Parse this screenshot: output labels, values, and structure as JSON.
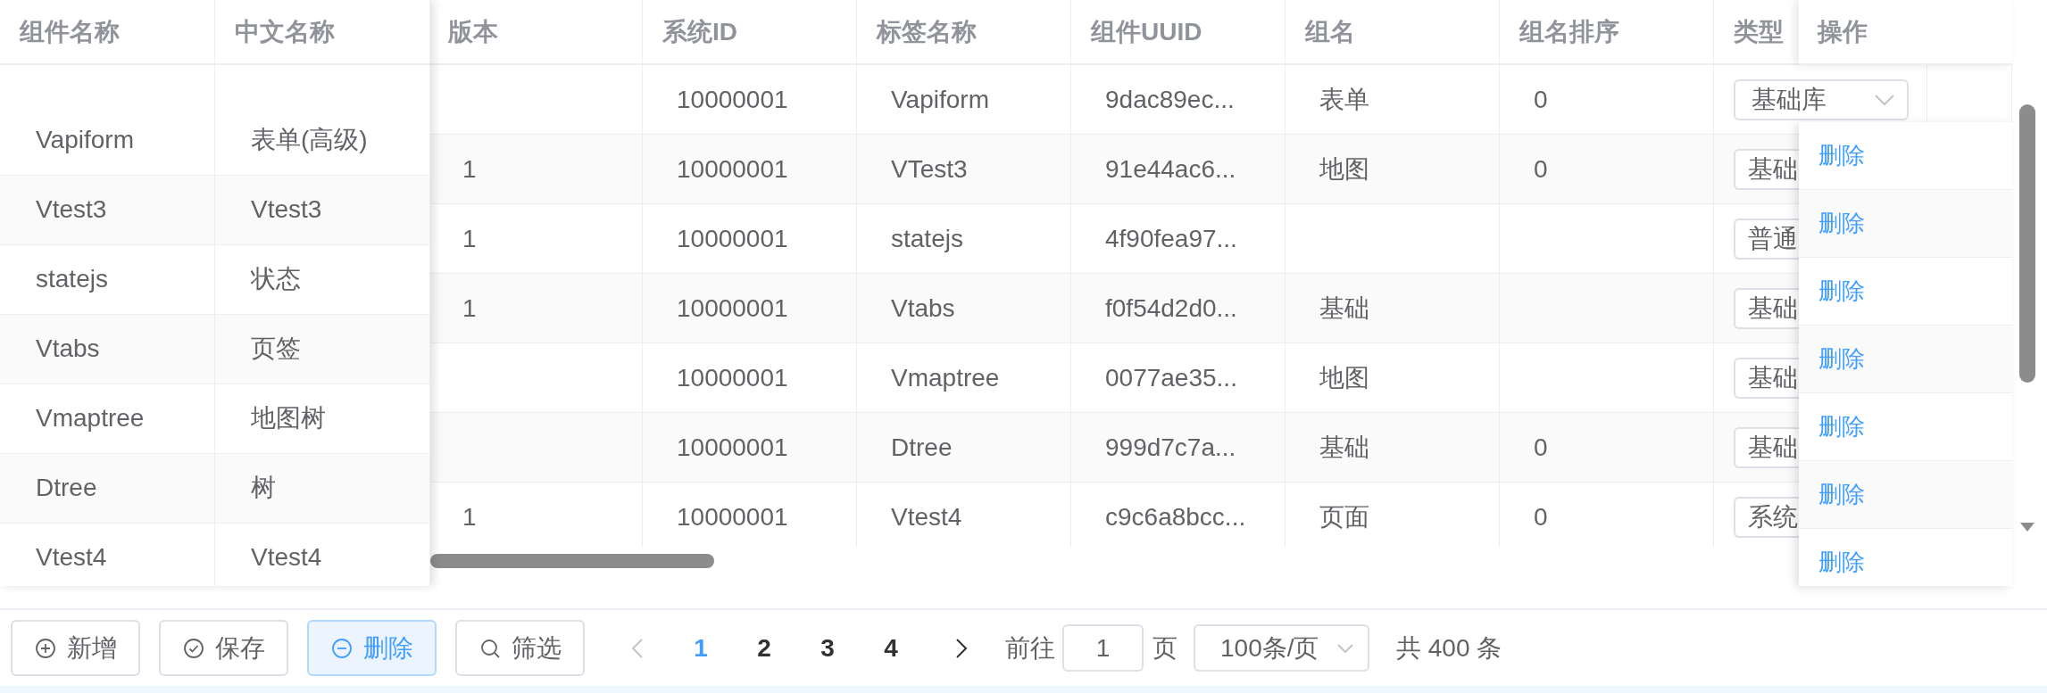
{
  "table": {
    "columns": [
      "组件名称",
      "中文名称",
      "版本",
      "系统ID",
      "标签名称",
      "组件UUID",
      "组名",
      "组名排序",
      "类型",
      "操作"
    ],
    "rows": [
      {
        "name": "Vapiform",
        "cn_name": "表单(高级)",
        "version": "",
        "system_id": "10000001",
        "tag_name": "Vapiform",
        "uuid": "9dac89ec...",
        "group": "表单",
        "group_order": "0",
        "type": "基础库",
        "action": "删除"
      },
      {
        "name": "Vtest3",
        "cn_name": "Vtest3",
        "version": "1",
        "system_id": "10000001",
        "tag_name": "VTest3",
        "uuid": "91e44ac6...",
        "group": "地图",
        "group_order": "0",
        "type": "基础",
        "action": "删除"
      },
      {
        "name": "statejs",
        "cn_name": "状态",
        "version": "1",
        "system_id": "10000001",
        "tag_name": "statejs",
        "uuid": "4f90fea97...",
        "group": "",
        "group_order": "",
        "type": "普通",
        "action": "删除"
      },
      {
        "name": "Vtabs",
        "cn_name": "页签",
        "version": "1",
        "system_id": "10000001",
        "tag_name": "Vtabs",
        "uuid": "f0f54d2d0...",
        "group": "基础",
        "group_order": "",
        "type": "基础",
        "action": "删除"
      },
      {
        "name": "Vmaptree",
        "cn_name": "地图树",
        "version": "",
        "system_id": "10000001",
        "tag_name": "Vmaptree",
        "uuid": "0077ae35...",
        "group": "地图",
        "group_order": "",
        "type": "基础",
        "action": "删除"
      },
      {
        "name": "Dtree",
        "cn_name": "树",
        "version": "",
        "system_id": "10000001",
        "tag_name": "Dtree",
        "uuid": "999d7c7a...",
        "group": "基础",
        "group_order": "0",
        "type": "基础",
        "action": "删除"
      },
      {
        "name": "Vtest4",
        "cn_name": "Vtest4",
        "version": "1",
        "system_id": "10000001",
        "tag_name": "Vtest4",
        "uuid": "c9c6a8bcc...",
        "group": "页面",
        "group_order": "0",
        "type": "系统",
        "action": "删除"
      }
    ]
  },
  "toolbar": [
    {
      "label": "新增",
      "kind": "plus",
      "active": false
    },
    {
      "label": "保存",
      "kind": "check",
      "active": false
    },
    {
      "label": "删除",
      "kind": "minus",
      "active": true
    },
    {
      "label": "筛选",
      "kind": "search",
      "active": false
    }
  ],
  "pagination": {
    "prev": {
      "disabled": true
    },
    "pages": [
      {
        "label": "1",
        "selected": true
      },
      {
        "label": "2",
        "selected": false
      },
      {
        "label": "3",
        "selected": false
      },
      {
        "label": "4",
        "selected": false
      }
    ],
    "next": {
      "disabled": false
    },
    "goto_label": "前往",
    "goto_value": "1",
    "page_label": "页",
    "page_size": "100条/页",
    "total": "共 400 条"
  }
}
